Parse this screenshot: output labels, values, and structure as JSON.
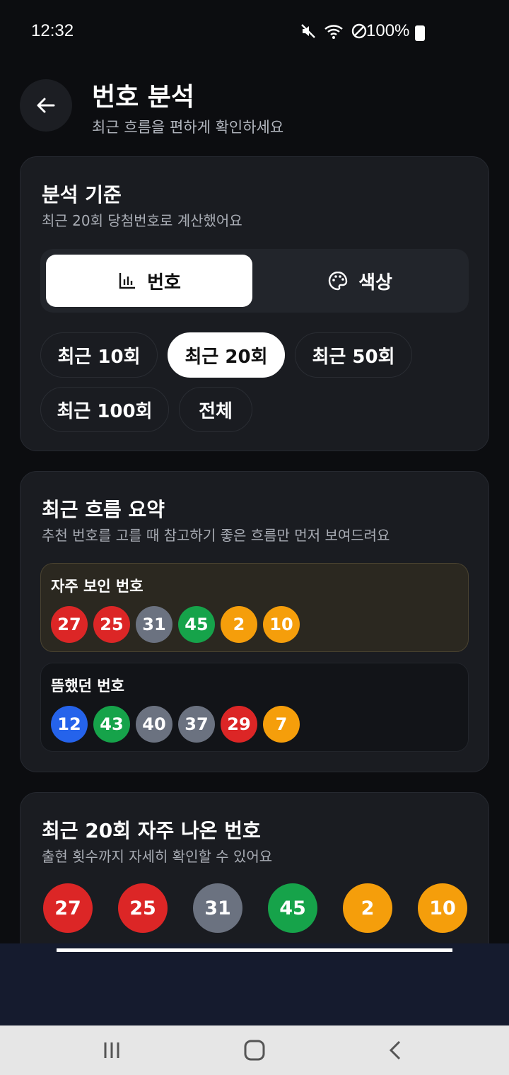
{
  "status": {
    "time": "12:32",
    "battery": "100%"
  },
  "header": {
    "title": "번호 분석",
    "subtitle": "최근 흐름을 편하게 확인하세요"
  },
  "criteria": {
    "title": "분석 기준",
    "subtitle": "최근 20회 당첨번호로 계산했어요",
    "tabs": [
      {
        "label": "번호",
        "icon": "bar-chart-icon",
        "active": true
      },
      {
        "label": "색상",
        "icon": "palette-icon",
        "active": false
      }
    ],
    "ranges": [
      {
        "label": "최근 10회",
        "selected": false
      },
      {
        "label": "최근 20회",
        "selected": true
      },
      {
        "label": "최근 50회",
        "selected": false
      },
      {
        "label": "최근 100회",
        "selected": false
      },
      {
        "label": "전체",
        "selected": false
      }
    ]
  },
  "summary": {
    "title": "최근 흐름 요약",
    "subtitle": "추천 번호를 고를 때 참고하기 좋은 흐름만 먼저 보여드려요",
    "hot": {
      "title": "자주 보인 번호",
      "numbers": [
        "27",
        "25",
        "31",
        "45",
        "2",
        "10"
      ]
    },
    "cold": {
      "title": "뜸했던 번호",
      "numbers": [
        "12",
        "43",
        "40",
        "37",
        "29",
        "7"
      ]
    }
  },
  "frequent": {
    "title": "최근 20회 자주 나온 번호",
    "subtitle": "출현 횟수까지 자세히 확인할 수 있어요",
    "numbers": [
      "27",
      "25",
      "31",
      "45",
      "2",
      "10"
    ]
  },
  "colors": {
    "red": "#dc2626",
    "gray": "#6b7280",
    "green": "#16a34a",
    "orange": "#f59e0b",
    "blue": "#2563eb"
  }
}
